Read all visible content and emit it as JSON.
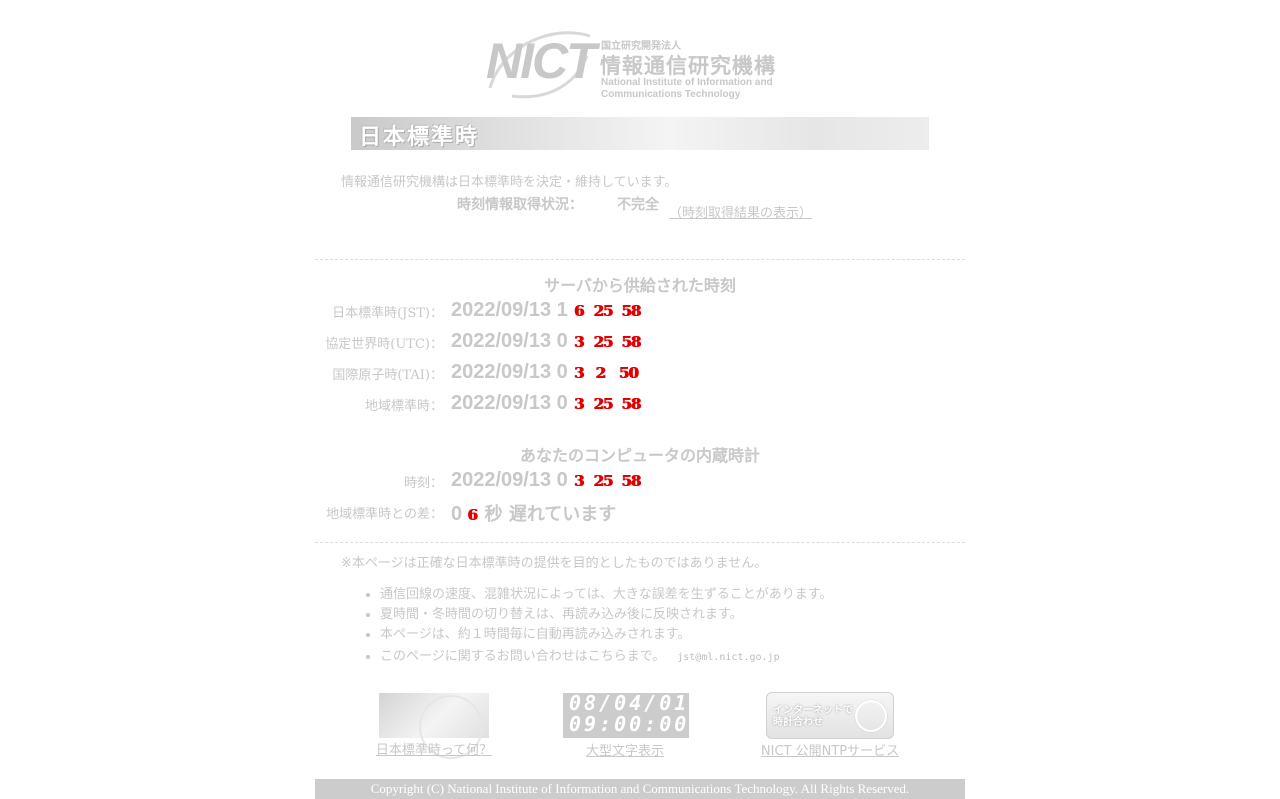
{
  "logo": {
    "mark": "NICT",
    "org_small": "国立研究開発法人",
    "org_name": "情報通信研究機構",
    "org_en_1": "National Institute of Information and",
    "org_en_2": "Communications Technology"
  },
  "banner": {
    "title": "日本標準時"
  },
  "intro": "情報通信研究機構は日本標準時を決定・維持しています。",
  "status": {
    "label": "時刻情報取得状況：",
    "value": "不完全",
    "link": "（時刻取得結果の表示）"
  },
  "server_section": {
    "title": "サーバから供給された時刻",
    "rows": [
      {
        "label": "日本標準時(JST)：",
        "date": "2022/09/13 1",
        "h": "6",
        "m": "25",
        "s": "58"
      },
      {
        "label": "協定世界時(UTC)：",
        "date": "2022/09/13 0",
        "h": "3",
        "m": "25",
        "s": "58"
      },
      {
        "label": "国際原子時(TAI)：",
        "date": "2022/09/13 0",
        "h": "3",
        "m": "2",
        "s": "50"
      },
      {
        "label": "地域標準時：",
        "date": "2022/09/13 0",
        "h": "3",
        "m": "25",
        "s": "58"
      }
    ]
  },
  "computer_section": {
    "title": "あなたのコンピュータの内蔵時計",
    "clock": {
      "label": "時刻：",
      "date": "2022/09/13 0",
      "h": "3",
      "m": "25",
      "s": "58"
    },
    "diff": {
      "label": "地域標準時との差：",
      "prefix": "0",
      "digit": "6",
      "suffix": "秒 遅れています"
    }
  },
  "note": "※本ページは正確な日本標準時の提供を目的としたものではありません。",
  "bullets": [
    "通信回線の速度、混雑状況によっては、大きな誤差を生ずることがあります。",
    "夏時間・冬時間の切り替えは、再読み込み後に反映されます。",
    "本ページは、約１時間毎に自動再読み込みされます。"
  ],
  "contact": {
    "text": "このページに関するお問い合わせはこちらまで。",
    "email": "jst@ml.nict.go.jp"
  },
  "bottom_links": {
    "what_is_jst": "日本標準時って何？",
    "large_display": "大型文字表示",
    "large_display_img_line1": "08/04/01",
    "large_display_img_line2": "09:00:00",
    "ntp_service": "NICT 公開NTPサービス",
    "ntp_img_line1": "インターネットで",
    "ntp_img_line2": "時計合わせ"
  },
  "footer": "Copyright (C) National Institute of Information and Communications Technology. All Rights Reserved."
}
